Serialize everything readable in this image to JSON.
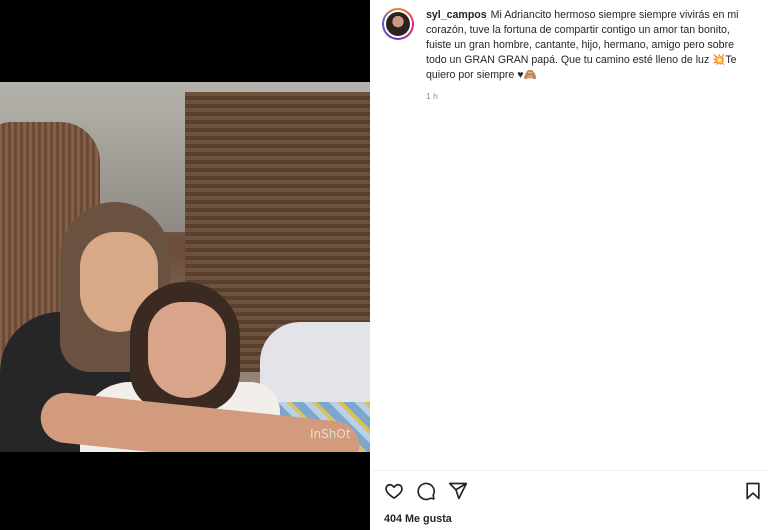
{
  "post": {
    "username": "syl_campos",
    "caption": "Mi Adriancito hermoso siempre siempre vivirás en mi corazón, tuve la fortuna de compartir contigo un amor tan bonito, fuiste un gran hombre, cantante, hijo, hermano, amigo pero sobre todo un GRAN GRAN papá. Que tu camino esté lleno de luz 💥Te quiero por siempre ♥🙈",
    "time_ago": "1 h",
    "likes_text": "404 Me gusta",
    "media_watermark": "InShOt"
  },
  "icons": {
    "like": "heart-icon",
    "comment": "comment-icon",
    "share": "send-icon",
    "save": "bookmark-icon"
  },
  "colors": {
    "avatar_ring": [
      "#f58529",
      "#dd2a7b",
      "#8134af",
      "#515bd4"
    ]
  }
}
